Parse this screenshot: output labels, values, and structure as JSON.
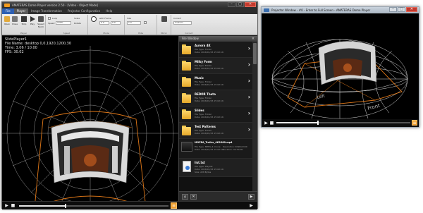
{
  "main_window": {
    "title": "AMATERAS Dome Player version 2.50 - [Video - Object Mode]",
    "controls": {
      "minimize": "–",
      "maximize": "□",
      "close": "✕"
    }
  },
  "menubar": {
    "file": "File",
    "items": [
      "Player",
      "Image Transformation",
      "Projector Configuration",
      "Help"
    ]
  },
  "ribbon": {
    "buttons": [
      {
        "label": "Open"
      },
      {
        "label": "Close"
      },
      {
        "label": "Stop"
      },
      {
        "label": "Play"
      },
      {
        "label": "Speed Norm"
      }
    ],
    "groups": [
      "Player",
      "Speed",
      "Mode",
      "Hide",
      "Mirror",
      "Correct"
    ],
    "fields": {
      "loop_label": "Loop",
      "speed_value": "100%",
      "speed_label": "Speed",
      "scale_label": "Scale",
      "rotate_label": "Rotate",
      "mode_label": "with Frame",
      "offset_x": "0.0",
      "offset_y": "0.0",
      "size_label": "Size",
      "size_value": "1.0",
      "hide_label": "Hide",
      "mirror_label": "Mirror",
      "correct_label": "Correct",
      "correct_value": "Custom"
    }
  },
  "viewport": {
    "line1": "SlidePlayer1",
    "line2": "File Name: desktop 0,0,1920,1200,30",
    "line3": "Time:   3.06 / 10.00",
    "line4": "FPS: 30.02"
  },
  "side_panel": {
    "title": "File Window",
    "items": [
      {
        "name": "Aurora 4K",
        "type": "File Type: Folder",
        "date": "Date: 2016/01/15 15:02:16"
      },
      {
        "name": "Milky Form",
        "type": "File Type: Folder",
        "date": "Date: 2016/01/15 15:02:16"
      },
      {
        "name": "Music",
        "type": "File Type: Folder",
        "date": "Date: 2016/01/15 15:02:16"
      },
      {
        "name": "REDOR Theta",
        "type": "File Type: Folder",
        "date": "Date: 2016/01/15 15:02:16"
      },
      {
        "name": "Slides",
        "type": "File Type: Folder",
        "date": "Date: 2016/01/15 15:02:16"
      },
      {
        "name": "Test Patterns",
        "type": "File Type: Folder",
        "date": "Date: 2016/01/15 15:02:16"
      },
      {
        "name": "MOZEA_Trailer_4K2K60.mp4",
        "type": "File Type: MPEG-4 movie",
        "date": "Date: 2016/01/15 15:02:16",
        "extra1": "Resolution: 4096x2160",
        "extra2": "Duration: 04:54:00"
      },
      {
        "name": "list.txt",
        "type": "File Type: Playlist",
        "date": "Date: 2016/01/15 15:02:16",
        "extra1": "Size: 228 Bytes"
      }
    ],
    "footer": {
      "home": "⌂",
      "delete": "✕",
      "play": "▶"
    }
  },
  "transport": {
    "play": "▶",
    "stop": "■",
    "settings": "≡",
    "progress": 0.31
  },
  "projector_window": {
    "title": "Projector Window - #0 - Enter to Full Screen - AMATERAS Dome Player",
    "controls": {
      "minimize": "–",
      "maximize": "□",
      "close": "✕"
    },
    "labels": {
      "left": "Left",
      "front": "Front"
    },
    "transport_progress": 0.31
  },
  "colors": {
    "accent": "#f0a030",
    "frame": "#e07818",
    "grid": "#ffffff"
  }
}
